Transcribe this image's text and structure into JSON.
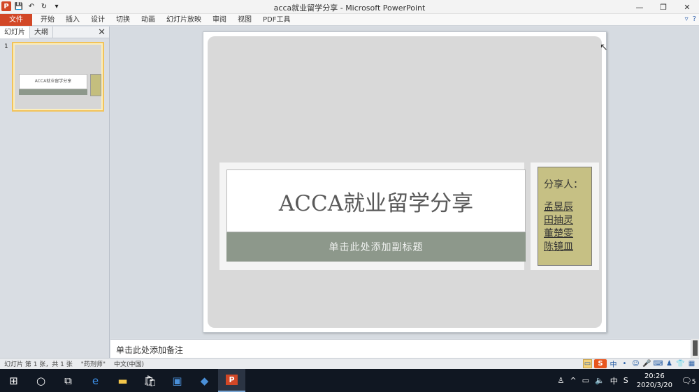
{
  "window": {
    "title": "acca就业留学分享 - Microsoft PowerPoint",
    "minimize": "—",
    "restore": "❐",
    "close": "✕"
  },
  "qat": {
    "logo": "P",
    "save": "💾",
    "undo": "↶",
    "redo": "↻",
    "more": "▾"
  },
  "ribbon": {
    "file_tab": "文件",
    "tabs": [
      "开始",
      "插入",
      "设计",
      "切换",
      "动画",
      "幻灯片放映",
      "审阅",
      "视图",
      "PDF工具"
    ],
    "minimize_ribbon": "▿",
    "help": "?"
  },
  "left_panel": {
    "tabs": [
      "幻灯片",
      "大纲"
    ],
    "close": "✕",
    "thumbnail_number": "1",
    "thumbnail_title": "ACCA就业留学分享"
  },
  "slide": {
    "title": "ACCA就业留学分享",
    "subtitle_placeholder": "单击此处添加副标题",
    "sharer_label": "分享人：",
    "names": [
      "孟昱辰",
      "田抽灵",
      "董楚雯",
      "陈镜皿"
    ]
  },
  "notes": {
    "placeholder": "单击此处添加备注"
  },
  "status": {
    "slide_info": "幻灯片 第 1 张，共 1 张",
    "theme": "\"药剂师\"",
    "language": "中文(中国)"
  },
  "taskbar": {
    "time": "20:26",
    "date": "2020/3/20",
    "notifications": "5"
  }
}
